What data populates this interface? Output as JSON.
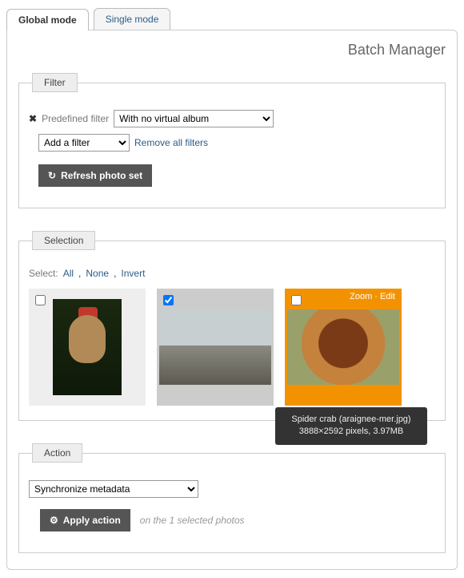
{
  "tabs": {
    "global": "Global mode",
    "single": "Single mode"
  },
  "page_title": "Batch Manager",
  "filter": {
    "legend": "Filter",
    "predefined_label": "Predefined filter",
    "predefined_selected": "With no virtual album",
    "add_filter_selected": "Add a filter",
    "remove_all": "Remove all filters",
    "refresh": "Refresh photo set"
  },
  "selection": {
    "legend": "Selection",
    "select_label": "Select:",
    "all": "All",
    "none": "None",
    "invert": "Invert",
    "thumb_hover": {
      "zoom": "Zoom",
      "edit": "Edit"
    },
    "tooltip_title": "Spider crab (araignee-mer.jpg)",
    "tooltip_meta": "3888×2592 pixels, 3.97MB"
  },
  "action": {
    "legend": "Action",
    "select_value": "Synchronize metadata",
    "apply": "Apply action",
    "note": "on the 1 selected photos"
  }
}
